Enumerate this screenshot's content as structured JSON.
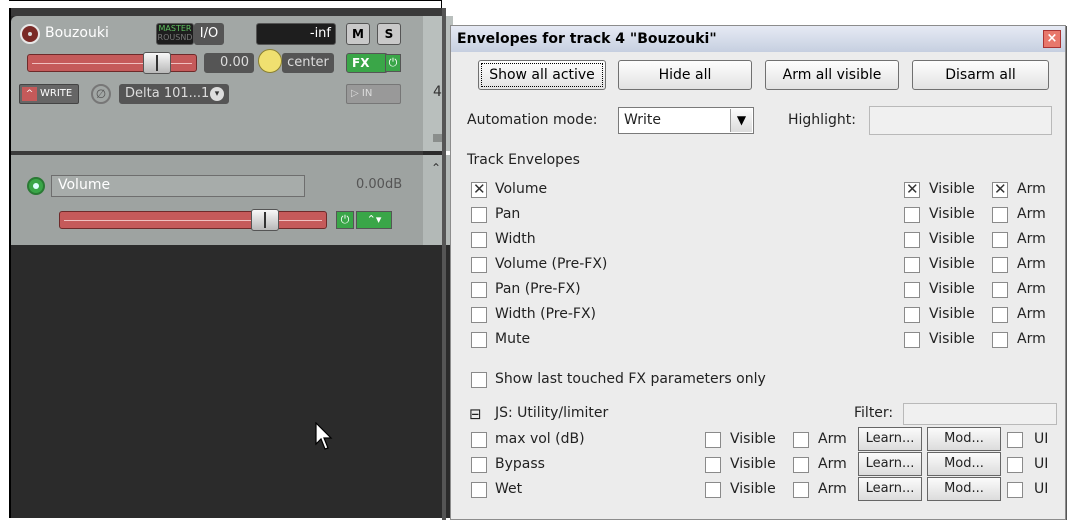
{
  "track": {
    "name": "Bouzouki",
    "master_label_top": "MASTER",
    "master_label_bottom": "ROUSND",
    "io_label": "I/O",
    "vol_readout": "-inf",
    "mute_label": "M",
    "solo_label": "S",
    "fader_value": "0.00",
    "pan_label": "center",
    "fx_label": "FX",
    "number": "4",
    "automation_mode_btn": "WRITE",
    "input_name": "Delta 101...1",
    "input_btn": "IN"
  },
  "env_lane": {
    "name": "Volume",
    "value": "0.00dB"
  },
  "dialog": {
    "title": "Envelopes for track 4 \"Bouzouki\"",
    "close": "×",
    "buttons": [
      "Show all active",
      "Hide all",
      "Arm all visible",
      "Disarm all"
    ],
    "automation_mode_label": "Automation mode:",
    "automation_mode_value": "Write",
    "highlight_label": "Highlight:",
    "highlight_value": "",
    "track_env_header": "Track Envelopes",
    "visible_label": "Visible",
    "arm_label": "Arm",
    "envelopes": [
      {
        "name": "Volume",
        "checked": true,
        "visible": true,
        "arm": true
      },
      {
        "name": "Pan",
        "checked": false,
        "visible": false,
        "arm": false
      },
      {
        "name": "Width",
        "checked": false,
        "visible": false,
        "arm": false
      },
      {
        "name": "Volume (Pre-FX)",
        "checked": false,
        "visible": false,
        "arm": false
      },
      {
        "name": "Pan (Pre-FX)",
        "checked": false,
        "visible": false,
        "arm": false
      },
      {
        "name": "Width (Pre-FX)",
        "checked": false,
        "visible": false,
        "arm": false
      },
      {
        "name": "Mute",
        "checked": false,
        "visible": false,
        "arm": false
      }
    ],
    "last_touched_label": "Show last touched FX parameters only",
    "fx_collapse": "⊟",
    "fx_name": "JS: Utility/limiter",
    "filter_label": "Filter:",
    "filter_value": "",
    "learn_label": "Learn...",
    "mod_label": "Mod...",
    "ui_label": "UI",
    "fx_params": [
      {
        "name": "max vol (dB)"
      },
      {
        "name": "Bypass"
      },
      {
        "name": "Wet"
      }
    ]
  },
  "colors": {
    "record_red": "#7a2a26",
    "fader_red": "#c55a5a",
    "green_btn": "#3aa648",
    "tcp_bg": "#9ea3a1",
    "arrange_bg": "#2b2b2b"
  }
}
